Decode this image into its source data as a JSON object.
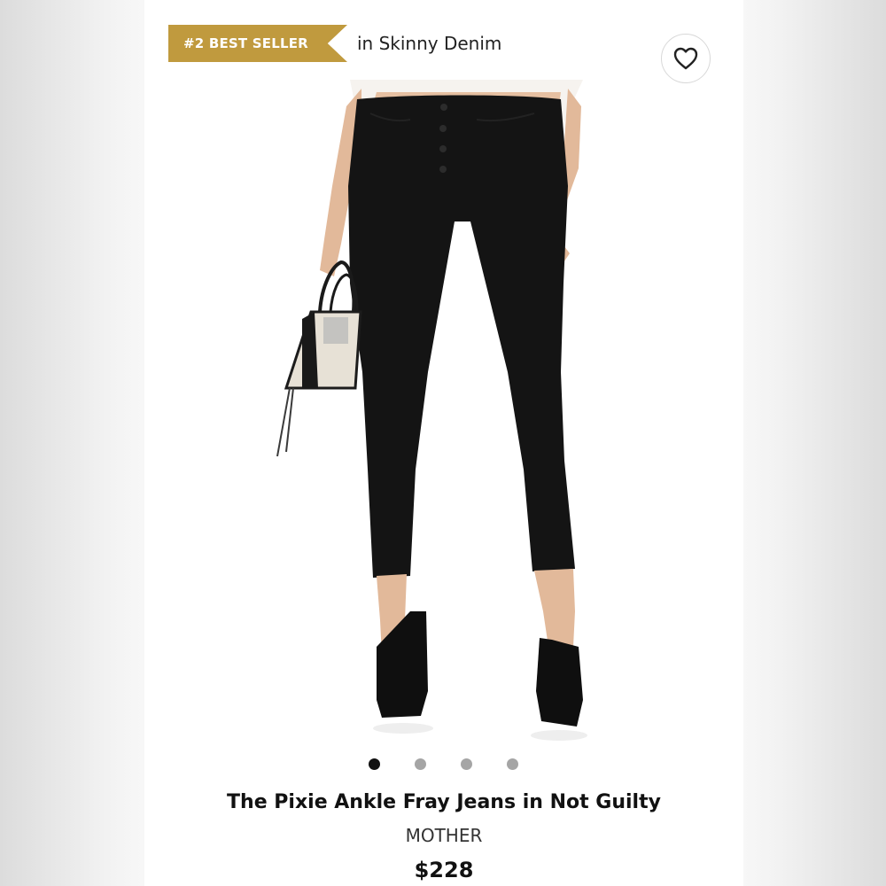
{
  "badge": {
    "label": "#2 BEST SELLER",
    "color": "#c09a3e"
  },
  "category": {
    "text": "in Skinny Denim"
  },
  "favorite": {
    "icon": "heart-outline-icon"
  },
  "gallery": {
    "total": 4,
    "active_index": 0,
    "dots": [
      "",
      "",
      "",
      ""
    ]
  },
  "product": {
    "title": "The Pixie Ankle Fray Jeans in Not Guilty",
    "brand": "MOTHER",
    "price": "$228"
  }
}
